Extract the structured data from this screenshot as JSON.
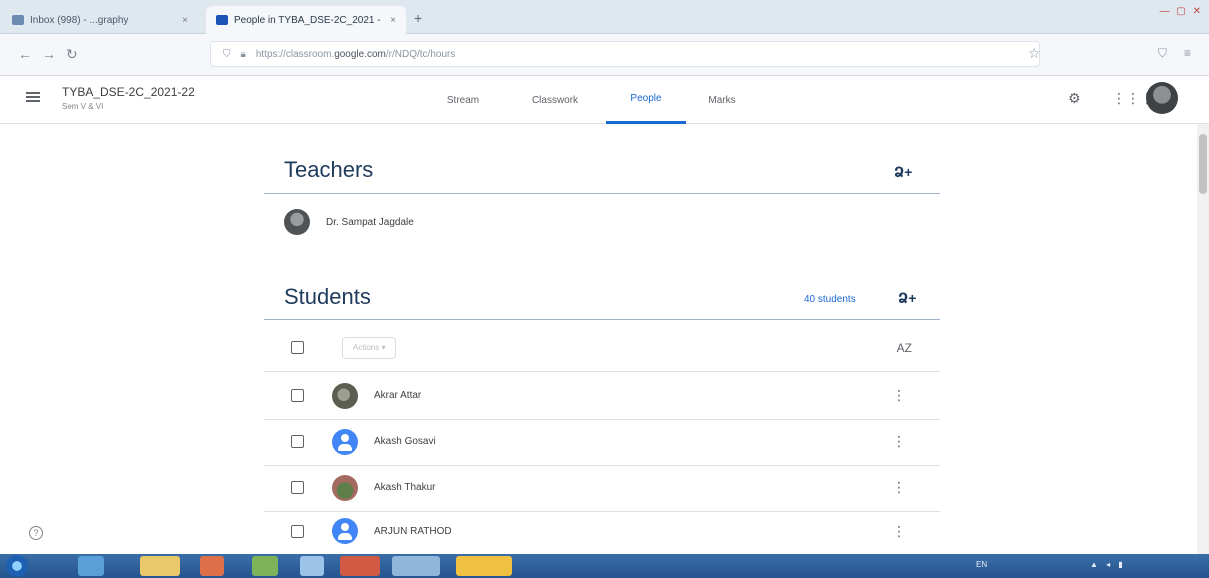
{
  "browser": {
    "tabs": [
      {
        "label": "Inbox (998) - ...graphy",
        "close": "×"
      },
      {
        "label": "People in TYBA_DSE-2C_2021 -",
        "close": "×"
      }
    ],
    "new_tab": "+",
    "url_prefix": "https://classroom.",
    "url_domain": "google.com",
    "url_suffix": "/r/NDQ/tc/hours",
    "nav": {
      "back": "←",
      "forward": "→",
      "reload": "↻"
    },
    "bookmark_star": "☆"
  },
  "classroom": {
    "class_name": "TYBA_DSE-2C_2021-22",
    "class_section": "Sem V & VI",
    "tabs": [
      "Stream",
      "Classwork",
      "People",
      "Marks"
    ],
    "active_tab": "People"
  },
  "teachers": {
    "title": "Teachers",
    "list": [
      {
        "name": "Dr. Sampat Jagdale"
      }
    ]
  },
  "students": {
    "title": "Students",
    "count_label": "40 students",
    "actions_label": "Actions ▾",
    "list": [
      {
        "name": "Akrar Attar"
      },
      {
        "name": "Akash Gosavi"
      },
      {
        "name": "Akash Thakur"
      },
      {
        "name": "ARJUN RATHOD"
      }
    ]
  },
  "icons": {
    "add_person": "Ձ+",
    "sort": "AZ",
    "kebab": "⋮",
    "help": "?"
  }
}
